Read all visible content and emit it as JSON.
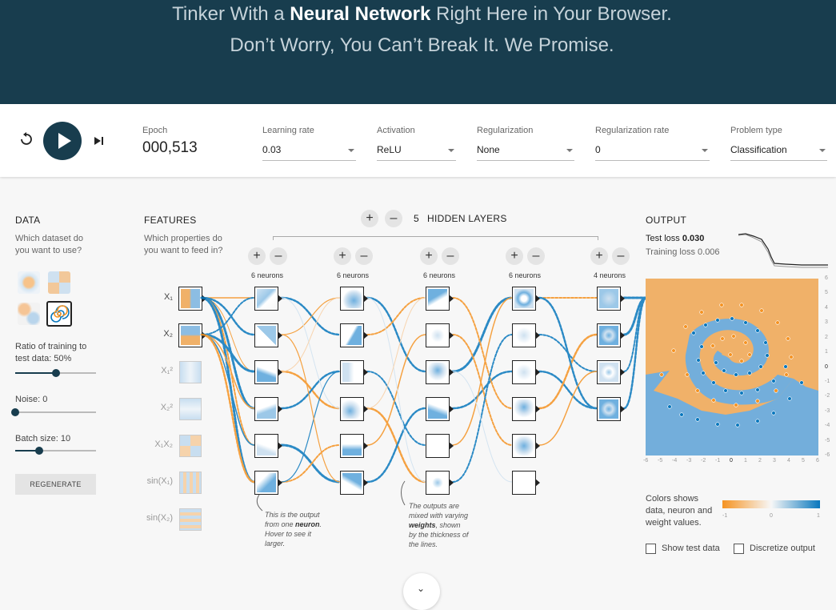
{
  "header": {
    "line1_pre": "Tinker With a ",
    "line1_bold": "Neural Network",
    "line1_post": " Right Here in Your Browser.",
    "line2": "Don’t Worry, You Can’t Break It. We Promise."
  },
  "controls": {
    "reset_icon": "reset-icon",
    "play_icon": "play-icon",
    "step_icon": "step-forward-icon",
    "epoch_label": "Epoch",
    "epoch_value": "000,513",
    "learning_rate_label": "Learning rate",
    "learning_rate_value": "0.03",
    "activation_label": "Activation",
    "activation_value": "ReLU",
    "regularization_label": "Regularization",
    "regularization_value": "None",
    "reg_rate_label": "Regularization rate",
    "reg_rate_value": "0",
    "problem_type_label": "Problem type",
    "problem_type_value": "Classification"
  },
  "data_panel": {
    "title": "DATA",
    "subtitle_line1": "Which dataset do",
    "subtitle_line2": "you want to use?",
    "ratio_label_line1": "Ratio of training to",
    "ratio_label_line2": "test data:  50%",
    "ratio_value": 0.5,
    "noise_label": "Noise:  0",
    "noise_value": 0,
    "batch_label": "Batch size:  10",
    "batch_value": 0.3,
    "regenerate": "REGENERATE"
  },
  "features_panel": {
    "title": "FEATURES",
    "subtitle_line1": "Which properties do",
    "subtitle_line2": "you want to feed in?",
    "features": [
      {
        "label": "X₁",
        "active": true
      },
      {
        "label": "X₂",
        "active": true
      },
      {
        "label": "X₁²",
        "active": false
      },
      {
        "label": "X₂²",
        "active": false
      },
      {
        "label": "X₁X₂",
        "active": false
      },
      {
        "label": "sin(X₁)",
        "active": false
      },
      {
        "label": "sin(X₂)",
        "active": false
      }
    ]
  },
  "hidden": {
    "count": "5",
    "label": "HIDDEN LAYERS",
    "layers": [
      {
        "neurons": "6 neurons"
      },
      {
        "neurons": "6 neurons"
      },
      {
        "neurons": "6 neurons"
      },
      {
        "neurons": "6 neurons"
      },
      {
        "neurons": "4 neurons"
      }
    ],
    "note1_line1": "This is the output",
    "note1_line2_pre": "from one ",
    "note1_line2_bold": "neuron",
    "note1_line2_post": ".",
    "note1_line3": "Hover to see it",
    "note1_line4": "larger.",
    "note2_line1": "The outputs are",
    "note2_line2": "mixed with varying",
    "note2_line3_bold": "weights",
    "note2_line3_post": ", shown",
    "note2_line4": "by the thickness of",
    "note2_line5": "the lines."
  },
  "output_panel": {
    "title": "OUTPUT",
    "test_loss_label": "Test loss ",
    "test_loss_value": "0.030",
    "training_loss_label": "Training loss ",
    "training_loss_value": "0.006",
    "colors_line1": "Colors shows",
    "colors_line2": "data, neuron and",
    "colors_line3": "weight values.",
    "legend_min": "-1",
    "legend_mid": "0",
    "legend_max": "1",
    "show_test": "Show test data",
    "discretize": "Discretize output",
    "x_ticks": [
      "-6",
      "-5",
      "-4",
      "-3",
      "-2",
      "-1",
      "0",
      "1",
      "2",
      "3",
      "4",
      "5",
      "6"
    ],
    "y_ticks": [
      "6",
      "5",
      "4",
      "3",
      "2",
      "1",
      "0",
      "-1",
      "-2",
      "-3",
      "-4",
      "-5",
      "-6"
    ]
  },
  "colors": {
    "orange": "#f59322",
    "blue": "#0877bd",
    "dark": "#183d4e"
  },
  "scroll_icon": "chevron-down-icon",
  "scroll_glyph": "⌄"
}
